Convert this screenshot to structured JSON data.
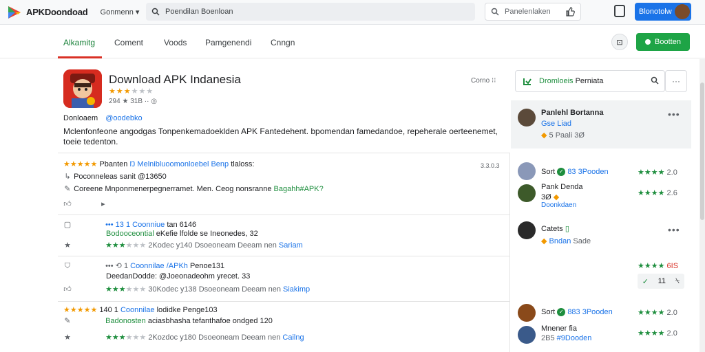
{
  "topbar": {
    "logo_text": "APKDoondoad",
    "category_label": "Gonmenn",
    "search_placeholder": "Poendilan Boenloan",
    "secondary_search": "Panelenlaken",
    "account_label": "Blonotolw"
  },
  "tabs": {
    "items": [
      {
        "label": "Alkamitg"
      },
      {
        "label": "Coment"
      },
      {
        "label": "Voods"
      },
      {
        "label": "Pamgenendi"
      },
      {
        "label": "Cnngn"
      }
    ],
    "circle_button": "⊡",
    "primary_button": "Bootten"
  },
  "app": {
    "title": "Download APK Indanesia",
    "rating_stars_filled": "★★★",
    "rating_stars_empty": "★★★",
    "meta": "294 ★ 31B ·· ◎",
    "more_link": "Corno ⁝⁝",
    "developer": "Donloaem",
    "developer_link": "@oodebko",
    "description": "Mclenfonfeone angodgas Tonpenkemadoeklden APK Fantedehent. bpomendan famedandoe, repeherale oerteenemet, toeie tedenton."
  },
  "reviews": [
    {
      "stars": "★★★★★",
      "line1_prefix": "Pbanten",
      "line1_link": "Ŋ Melnibluoomonloebel Benp",
      "line1_suffix": "tlaloss:",
      "time": "3.3.0.3",
      "line2": "Poconneleas sanit @13650",
      "line3_prefix": "Coreene Mnponmenerpegnerramet. Men. Ceog nonsranne",
      "line3_link": "Bagahh#APK?"
    },
    {
      "stars": "••• 13 1",
      "line1_link": "Coonniue",
      "line1_suffix": "tan 6146",
      "line2_prefix": "Bodooceontial",
      "line2_suffix": "eKefie lfolde se Ineonedes, 32",
      "line3_stars": "★★★",
      "line3_gray": "★★★",
      "line3": "2Kodec",
      "line3_mid": "y140 Dsoeoneam Deeam nen",
      "line3_link": "Sariam"
    },
    {
      "stars": "••• ⟲ 1",
      "line1_link": "Coonnilae /APKh",
      "line1_suffix": "Penoe131",
      "line2": "DeedanDodde: @Joeonadeohm yrecet. 33",
      "line3_stars": "★★★",
      "line3_gray": "★★★",
      "line3": "30Kodec",
      "line3_mid": "y138 Dsoeoneam Deeam nen",
      "line3_link": "Siakimp"
    },
    {
      "stars": "★★★★★",
      "line1_prefix": "140 1",
      "line1_link": "Coonnilae",
      "line1_suffix": "lodidke Penge103",
      "line2_prefix": "Badonosten",
      "line2_suffix": "aciasbhasha tefanthafoe ondged 120",
      "line3_stars": "★★★",
      "line3_gray": "★★★",
      "line3": "2Kozdoc",
      "line3_mid": "y180 Dsoeoneam Deeam nen",
      "line3_link": "Cailng"
    }
  ],
  "sidebar": {
    "search_label": "Dromloeis",
    "search_suffix": "Perniata",
    "more": "···",
    "featured": {
      "name": "Panlehl Bortanna",
      "sub": "Gse Liad",
      "meta": "5 Paali 3Ø"
    },
    "items": [
      {
        "name": "Sort",
        "link": "83 3Pooden",
        "stars": "★★★★",
        "score": "2.0"
      },
      {
        "name": "Pank Denda",
        "sub": "3Ø",
        "meta": "Doonkdaen",
        "stars": "★★★★",
        "score": "2.6"
      },
      {
        "name": "Catets",
        "sub": "Bndan",
        "meta": "Sade",
        "score": ""
      },
      {
        "name": "",
        "stars": "★★★★",
        "score": "6IS"
      },
      {
        "name": "Sort",
        "link": "883 3Pooden",
        "stars": "★★★★",
        "score": "2.0"
      },
      {
        "name": "Mnener fia",
        "link": "#9Dooden",
        "meta": "2B5",
        "stars": "★★★★",
        "score": "2.0"
      }
    ],
    "mini_box": {
      "left": "11",
      "right": "⍀"
    }
  },
  "colors": {
    "accent_blue": "#1a73e8",
    "accent_green": "#1e8e3e",
    "tab_indicator": "#d93025",
    "star_orange": "#f29900"
  }
}
